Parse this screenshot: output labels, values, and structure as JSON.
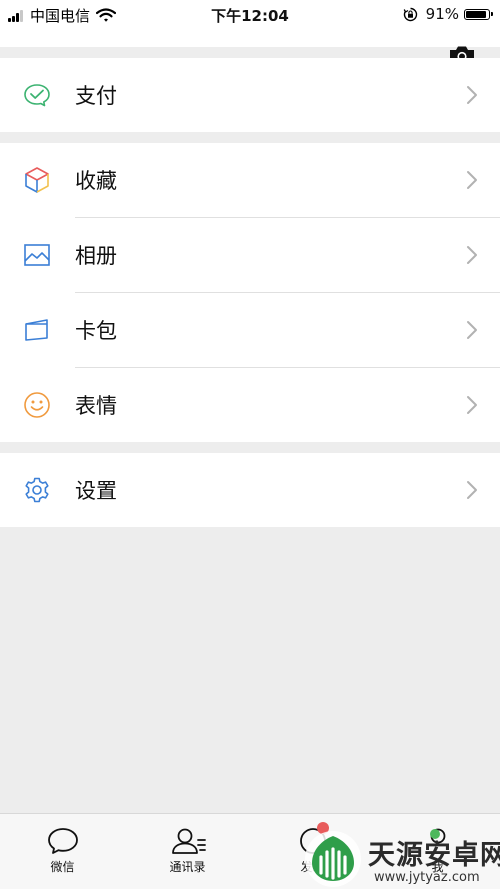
{
  "status_bar": {
    "carrier": "中国电信",
    "time": "下午12:04",
    "battery_text": "91%",
    "battery_level": 0.91
  },
  "groups": [
    {
      "items": [
        {
          "label": "支付",
          "icon": "wechat-pay-icon",
          "color": "#3cb371"
        }
      ]
    },
    {
      "items": [
        {
          "label": "收藏",
          "icon": "favorites-cube-icon",
          "color": "#e85c5c"
        },
        {
          "label": "相册",
          "icon": "album-picture-icon",
          "color": "#3b7fd6"
        },
        {
          "label": "卡包",
          "icon": "card-wallet-icon",
          "color": "#3b7fd6"
        },
        {
          "label": "表情",
          "icon": "sticker-smiley-icon",
          "color": "#f09a3e"
        }
      ]
    },
    {
      "items": [
        {
          "label": "设置",
          "icon": "settings-gear-icon",
          "color": "#3b7fd6"
        }
      ]
    }
  ],
  "tabbar": {
    "tabs": [
      {
        "label": "微信",
        "icon": "chat-bubble-icon"
      },
      {
        "label": "通讯录",
        "icon": "contacts-icon"
      },
      {
        "label": "发现",
        "icon": "discover-compass-icon"
      },
      {
        "label": "我",
        "icon": "me-person-icon"
      }
    ]
  },
  "watermark": {
    "title": "天源安卓网",
    "url": "www.jytyaz.com"
  }
}
